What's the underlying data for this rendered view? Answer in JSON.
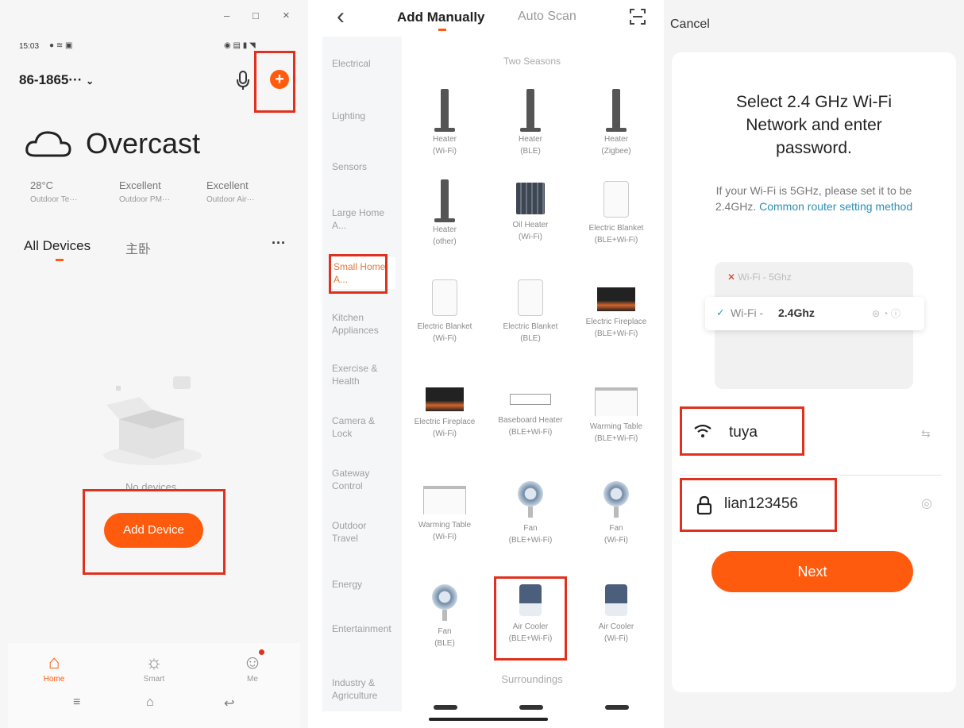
{
  "panel1": {
    "window_controls": {
      "minimize": "–",
      "maximize": "□",
      "close": "×"
    },
    "status_time": "15:03",
    "account": "86-1865···",
    "weather": {
      "condition": "Overcast"
    },
    "stats": [
      {
        "value": "28°C",
        "label": "Outdoor Te···"
      },
      {
        "value": "Excellent",
        "label": "Outdoor PM···"
      },
      {
        "value": "Excellent",
        "label": "Outdoor Air···"
      }
    ],
    "tabs": [
      "All Devices",
      "主卧"
    ],
    "more": "···",
    "empty_text": "No devices",
    "add_device": "Add Device",
    "nav": [
      "Home",
      "Smart",
      "Me"
    ]
  },
  "panel2": {
    "back": "‹",
    "tabs": [
      "Add Manually",
      "Auto Scan"
    ],
    "categories": [
      "Electrical",
      "Lighting",
      "Sensors",
      "Large Home A...",
      "Small Home A...",
      "Kitchen Appliances",
      "Exercise & Health",
      "Camera & Lock",
      "Gateway Control",
      "Outdoor Travel",
      "Energy",
      "Entertainment",
      "Industry & Agriculture"
    ],
    "section_title": "Two Seasons",
    "footer_section": "Surroundings",
    "devices": [
      {
        "name": "Heater",
        "sub": "(Wi-Fi)",
        "icon": "heater-tower-icon"
      },
      {
        "name": "Heater",
        "sub": "(BLE)",
        "icon": "heater-tower-icon"
      },
      {
        "name": "Heater",
        "sub": "(Zigbee)",
        "icon": "heater-tower-icon"
      },
      {
        "name": "Heater",
        "sub": "(other)",
        "icon": "heater-tower-icon"
      },
      {
        "name": "Oil Heater",
        "sub": "(Wi-Fi)",
        "icon": "oil-heater-icon"
      },
      {
        "name": "Electric Blanket",
        "sub": "(BLE+Wi-Fi)",
        "icon": "blanket-icon"
      },
      {
        "name": "Electric Blanket",
        "sub": "(Wi-Fi)",
        "icon": "blanket-icon"
      },
      {
        "name": "Electric Blanket",
        "sub": "(BLE)",
        "icon": "blanket-icon"
      },
      {
        "name": "Electric Fireplace",
        "sub": "(BLE+Wi-Fi)",
        "icon": "fireplace-icon"
      },
      {
        "name": "Electric Fireplace",
        "sub": "(Wi-Fi)",
        "icon": "fireplace-icon"
      },
      {
        "name": "Baseboard Heater",
        "sub": "(BLE+Wi-Fi)",
        "icon": "baseboard-heater-icon"
      },
      {
        "name": "Warming Table",
        "sub": "(BLE+Wi-Fi)",
        "icon": "warming-table-icon"
      },
      {
        "name": "Warming Table",
        "sub": "(Wi-Fi)",
        "icon": "warming-table-icon"
      },
      {
        "name": "Fan",
        "sub": "(BLE+Wi-Fi)",
        "icon": "fan-icon"
      },
      {
        "name": "Fan",
        "sub": "(Wi-Fi)",
        "icon": "fan-icon"
      },
      {
        "name": "Fan",
        "sub": "(BLE)",
        "icon": "fan-icon"
      },
      {
        "name": "Air Cooler",
        "sub": "(BLE+Wi-Fi)",
        "icon": "air-cooler-icon"
      },
      {
        "name": "Air Cooler",
        "sub": "(Wi-Fi)",
        "icon": "air-cooler-icon"
      }
    ]
  },
  "panel3": {
    "cancel": "Cancel",
    "title": "Select 2.4 GHz Wi-Fi Network and enter password.",
    "hint_prefix": "If your Wi-Fi is 5GHz, please set it to be 2.4GHz.",
    "hint_link": "Common router setting method",
    "wifi_bad_prefix": "Wi-Fi - ",
    "wifi_bad_band": "5Ghz",
    "wifi_good_prefix": "Wi-Fi - ",
    "wifi_good_band": "2.4Ghz",
    "ssid": "tuya",
    "password": "lian123456",
    "next": "Next"
  },
  "colors": {
    "accent": "#ff5b0f",
    "highlight_box": "#e0301e",
    "link": "#2a8fb5"
  }
}
